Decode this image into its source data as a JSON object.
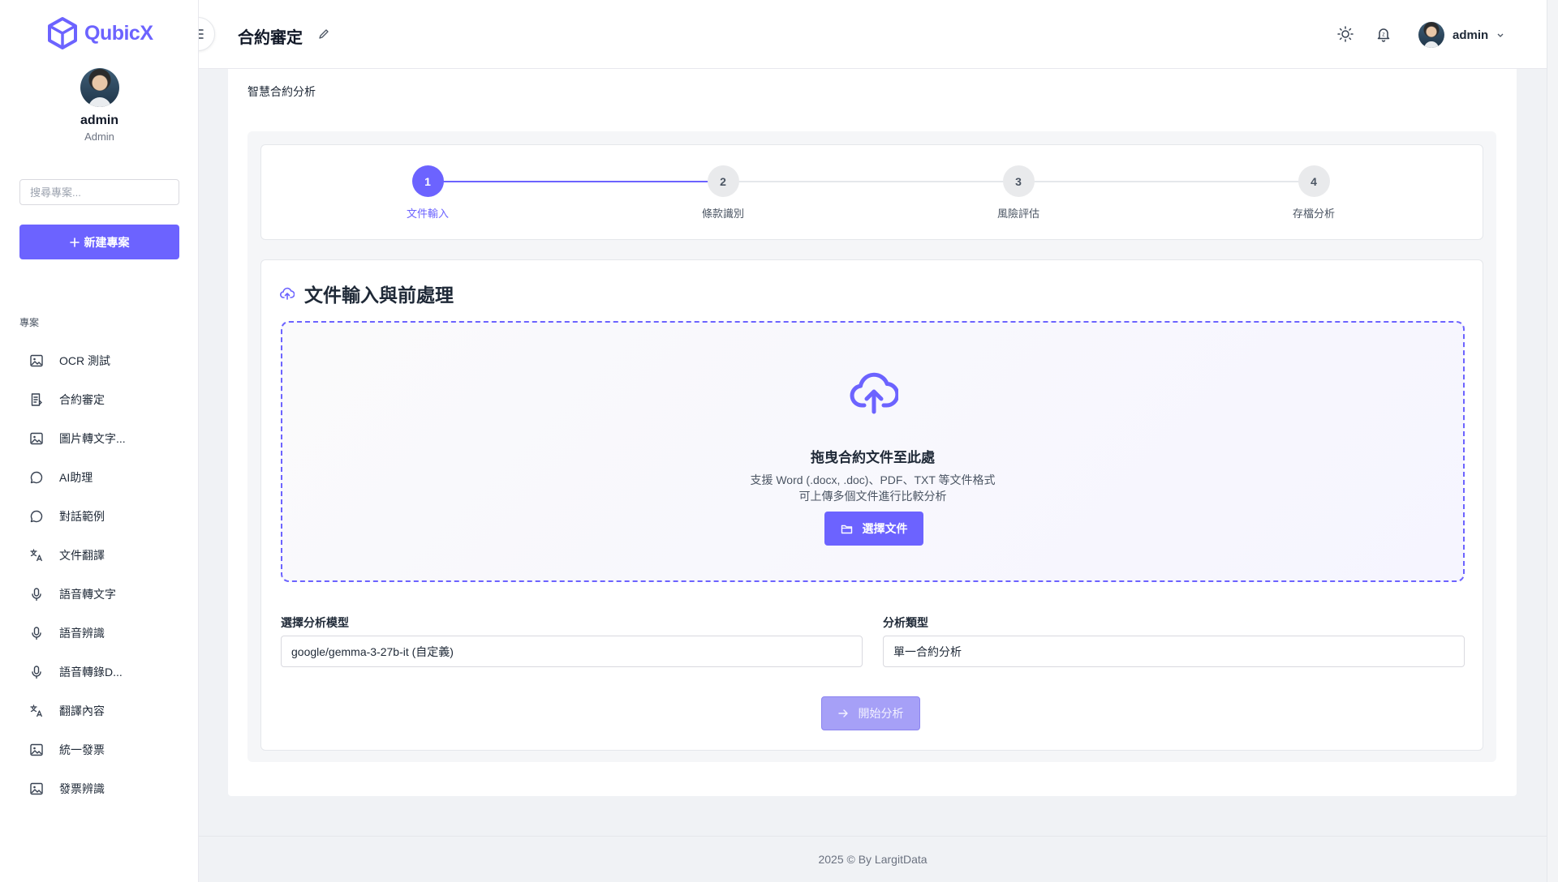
{
  "app": {
    "name": "QubicX"
  },
  "profile": {
    "name": "admin",
    "role": "Admin"
  },
  "sidebar": {
    "search_placeholder": "搜尋專案...",
    "new_project_label": "新建專案",
    "section_label": "專案",
    "items": [
      {
        "label": "OCR 測試",
        "icon": "image-icon"
      },
      {
        "label": "合約審定",
        "icon": "document-icon"
      },
      {
        "label": "圖片轉文字...",
        "icon": "image-icon"
      },
      {
        "label": "AI助理",
        "icon": "chat-icon"
      },
      {
        "label": "對話範例",
        "icon": "chat-icon"
      },
      {
        "label": "文件翻譯",
        "icon": "translate-icon"
      },
      {
        "label": "語音轉文字",
        "icon": "microphone-icon"
      },
      {
        "label": "語音辨識",
        "icon": "microphone-icon"
      },
      {
        "label": "語音轉錄D...",
        "icon": "microphone-icon"
      },
      {
        "label": "翻譯內容",
        "icon": "translate-icon"
      },
      {
        "label": "統一發票",
        "icon": "image-icon"
      },
      {
        "label": "發票辨識",
        "icon": "image-icon"
      }
    ]
  },
  "header": {
    "title": "合約審定",
    "user": "admin"
  },
  "main": {
    "breadcrumb": "智慧合約分析",
    "steps": [
      {
        "number": "1",
        "label": "文件輸入",
        "active": true
      },
      {
        "number": "2",
        "label": "條款識別",
        "active": false
      },
      {
        "number": "3",
        "label": "風險評估",
        "active": false
      },
      {
        "number": "4",
        "label": "存檔分析",
        "active": false
      }
    ],
    "upload": {
      "title": "文件輸入與前處理",
      "drop_title": "拖曳合約文件至此處",
      "drop_sub1": "支援 Word (.docx, .doc)、PDF、TXT 等文件格式",
      "drop_sub2": "可上傳多個文件進行比較分析",
      "choose_label": "選擇文件"
    },
    "model": {
      "label": "選擇分析模型",
      "value": "google/gemma-3-27b-it (自定義)"
    },
    "analysis_type": {
      "label": "分析類型",
      "value": "單一合約分析"
    },
    "start_label": "開始分析"
  },
  "footer": {
    "text": "2025 © By LargitData"
  },
  "colors": {
    "accent": "#6c63ff",
    "accent_disabled": "#a6a0f7"
  }
}
